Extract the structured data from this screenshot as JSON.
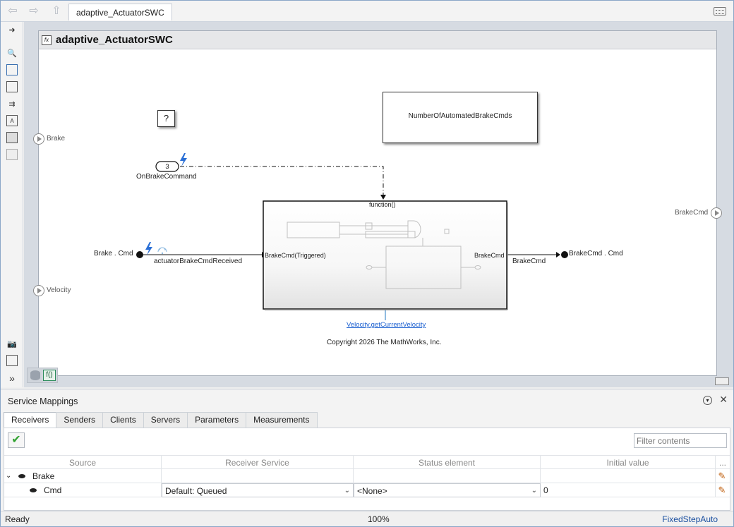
{
  "window": {
    "tab_label": "adaptive_ActuatorSWC"
  },
  "canvas": {
    "title": "adaptive_ActuatorSWC",
    "inports": [
      {
        "label": "Brake"
      },
      {
        "label": "Velocity"
      }
    ],
    "outport_label": "BrakeCmd",
    "unknown_block": "?",
    "function_caller_number": "3",
    "function_caller_label": "OnBrakeCommand",
    "receive_block_label": "Brake . Cmd",
    "receive_signal_label": "actuatorBrakeCmdReceived",
    "subsystem": {
      "trigger_label": "function()",
      "in_port_label": "BrakeCmd(Triggered)",
      "out_port_label": "BrakeCmd"
    },
    "out_signal_label": "BrakeCmd",
    "send_block_label": "BrakeCmd . Cmd",
    "store_block_label": "NumberOfAutomatedBrakeCmds",
    "function_link": "Velocity.getCurrentVelocity",
    "copyright": "Copyright 2026 The MathWorks, Inc.",
    "bottom_icon_label": "f()"
  },
  "panel": {
    "title": "Service Mappings",
    "tabs": [
      "Receivers",
      "Senders",
      "Clients",
      "Servers",
      "Parameters",
      "Measurements"
    ],
    "active_tab": "Receivers",
    "filter_placeholder": "Filter contents",
    "columns": [
      "Source",
      "Receiver Service",
      "Status element",
      "Initial value",
      "..."
    ],
    "rows": [
      {
        "source": "Brake",
        "receiver_service": "",
        "status_element": "",
        "initial_value": ""
      },
      {
        "source": "Cmd",
        "receiver_service": "Default: Queued",
        "status_element": "<None>",
        "initial_value": "0"
      }
    ]
  },
  "status": {
    "left": "Ready",
    "zoom": "100%",
    "solver": "FixedStepAuto"
  },
  "colors": {
    "link": "#1a5fd0",
    "accent_lightning": "#2a6fd6",
    "check": "#2ea12e"
  }
}
